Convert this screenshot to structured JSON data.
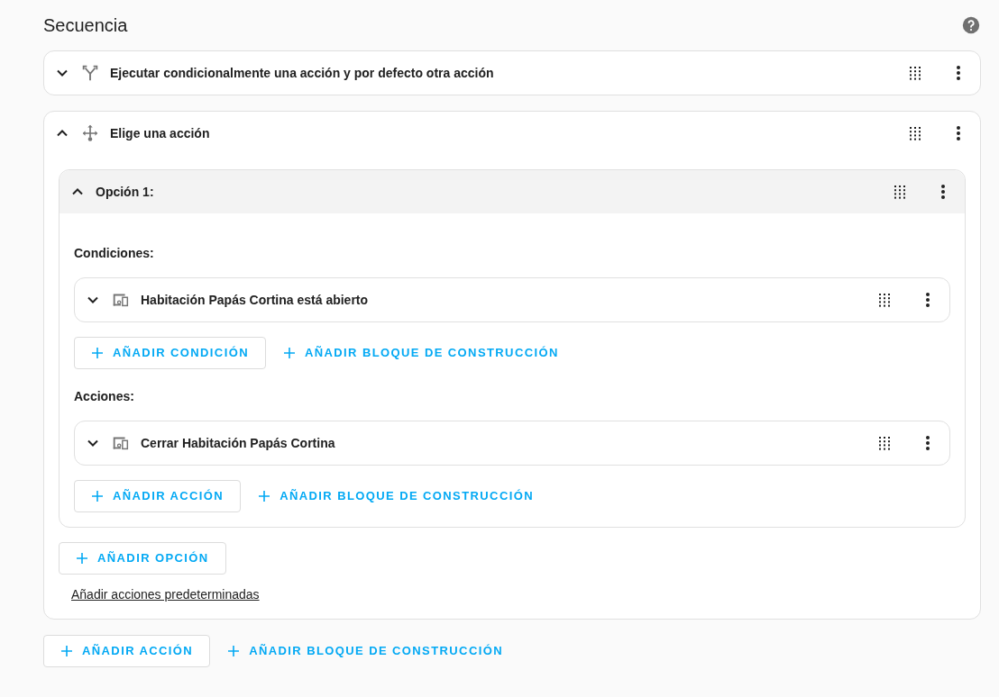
{
  "title": "Secuencia",
  "actions": [
    {
      "label": "Ejecutar condicionalmente una acción y por defecto otra acción",
      "kind": "branch",
      "expanded": false
    },
    {
      "label": "Elige una acción",
      "kind": "choose",
      "expanded": true,
      "options": [
        {
          "label": "Opción 1:",
          "expanded": true,
          "conditions_label": "Condiciones:",
          "conditions": [
            {
              "label": "Habitación Papás Cortina está abierto",
              "kind": "device",
              "expanded": false
            }
          ],
          "condition_buttons": [
            {
              "label": "AÑADIR CONDICIÓN",
              "kind": "outlined"
            },
            {
              "label": "AÑADIR BLOQUE DE CONSTRUCCIÓN",
              "kind": "text"
            }
          ],
          "actions_label": "Acciones:",
          "actions": [
            {
              "label": "Cerrar Habitación Papás Cortina",
              "kind": "device",
              "expanded": false
            }
          ],
          "action_buttons": [
            {
              "label": "AÑADIR ACCIÓN",
              "kind": "outlined"
            },
            {
              "label": "AÑADIR BLOQUE DE CONSTRUCCIÓN",
              "kind": "text"
            }
          ]
        }
      ],
      "option_buttons": [
        {
          "label": "AÑADIR OPCIÓN",
          "kind": "outlined"
        }
      ],
      "default_link": "Añadir acciones predeterminadas"
    }
  ],
  "buttons": [
    {
      "label": "AÑADIR ACCIÓN",
      "kind": "outlined"
    },
    {
      "label": "AÑADIR BLOQUE DE CONSTRUCCIÓN",
      "kind": "text"
    }
  ]
}
